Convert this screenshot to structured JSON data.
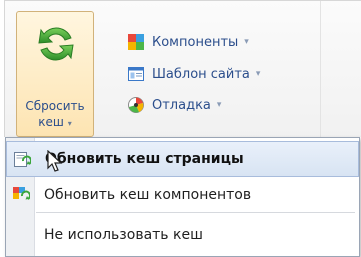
{
  "toolbar": {
    "reset_cache": {
      "line1": "Сбросить",
      "line2": "кеш",
      "arrow": "▾",
      "icon": "refresh-icon"
    },
    "components": {
      "label": "Компоненты",
      "arrow": "▾",
      "icon": "components-icon"
    },
    "site_template": {
      "label": "Шаблон сайта",
      "arrow": "▾",
      "icon": "template-icon"
    },
    "debug": {
      "label": "Отладка",
      "arrow": "▾",
      "icon": "debug-icon"
    }
  },
  "menu": {
    "items": [
      {
        "label": "Обновить кеш страницы",
        "icon": "refresh-page-icon",
        "highlighted": true
      },
      {
        "label": "Обновить кеш компонентов",
        "icon": "refresh-components-icon"
      },
      {
        "label": "Не использовать кеш"
      }
    ]
  },
  "colors": {
    "accent_text": "#2b4e8c",
    "highlight_bg": "#dce7f5",
    "refresh_green": "#3aa53a"
  }
}
